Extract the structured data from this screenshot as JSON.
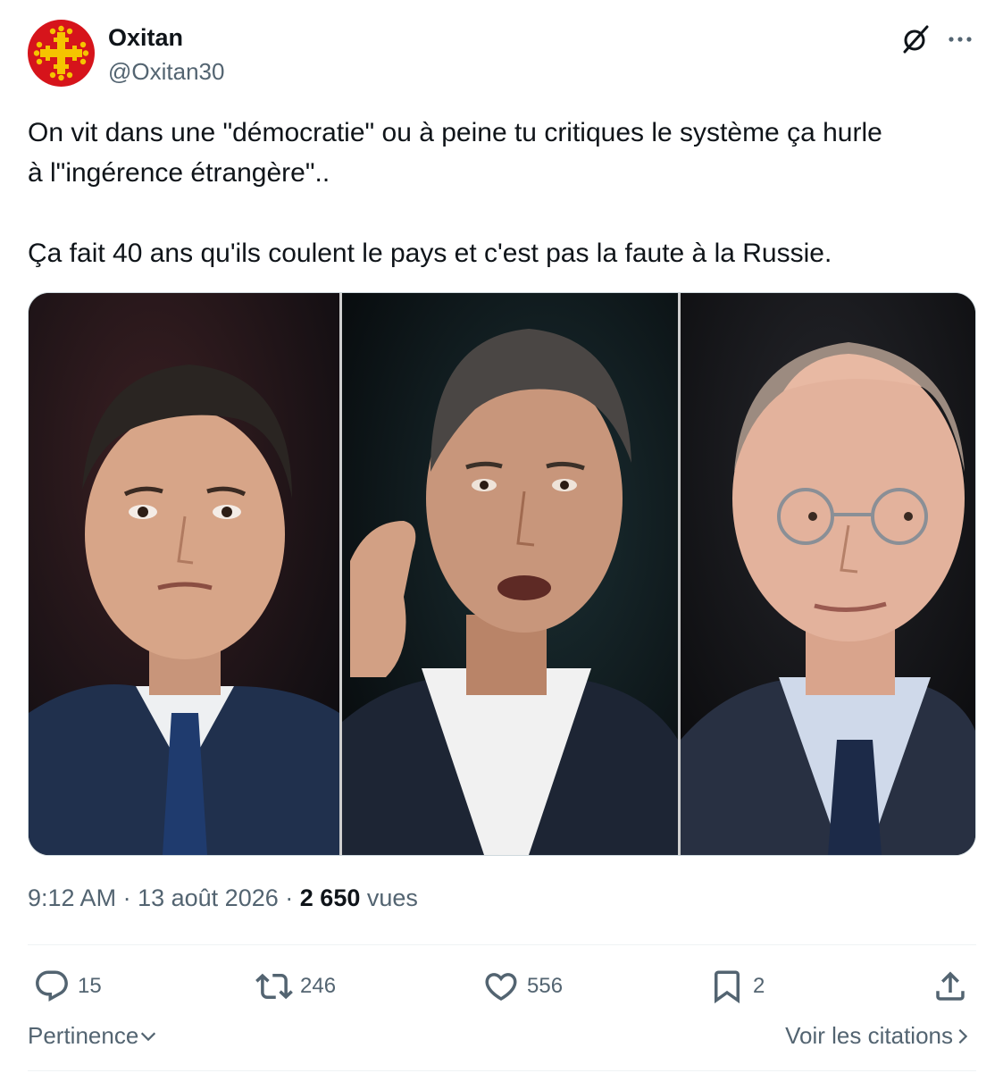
{
  "author": {
    "name": "Oxitan",
    "handle": "@Oxitan30",
    "avatar_icon": "occitan-cross-icon",
    "avatar_bg": "#d6141b",
    "avatar_fg": "#f5c400"
  },
  "header_icons": [
    "grok-icon",
    "more-icon"
  ],
  "tweet": {
    "line1": "On vit dans une \"démocratie\" ou à peine tu critiques le système ça hurle",
    "line2": "à l\"ingérence étrangère\"..",
    "line3": "Ça fait 40 ans qu'ils coulent le pays et c'est pas la faute à la Russie."
  },
  "media": {
    "panel_count": 3
  },
  "meta": {
    "time": "9:12 AM",
    "separator": "·",
    "date": "13 août 2026",
    "views_count": "2 650",
    "views_label": "vues"
  },
  "actions": {
    "replies": {
      "icon": "reply-icon",
      "count": "15"
    },
    "reposts": {
      "icon": "repost-icon",
      "count": "246"
    },
    "likes": {
      "icon": "heart-icon",
      "count": "556"
    },
    "bookmarks": {
      "icon": "bookmark-icon",
      "count": "2"
    },
    "share": {
      "icon": "share-icon"
    }
  },
  "footer": {
    "sort_label": "Pertinence",
    "quotes_label": "Voir les citations"
  },
  "colors": {
    "text_primary": "#0f1419",
    "text_secondary": "#536471",
    "divider": "#eff3f4"
  }
}
